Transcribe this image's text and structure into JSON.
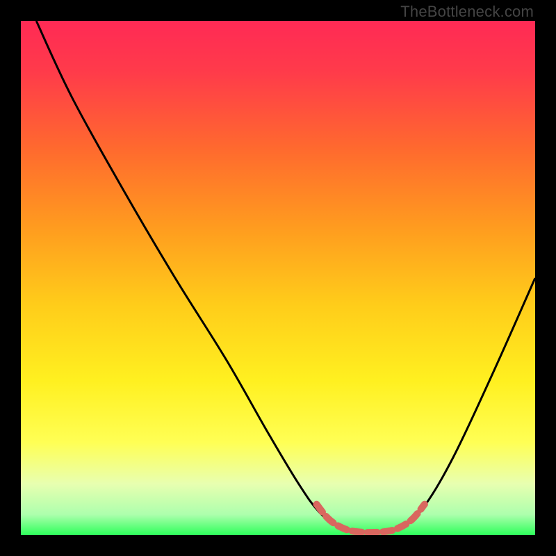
{
  "watermark": "TheBottleneck.com",
  "chart_data": {
    "type": "line",
    "title": "",
    "xlabel": "",
    "ylabel": "",
    "xlim": [
      0,
      100
    ],
    "ylim": [
      0,
      100
    ],
    "gradient_stops": [
      {
        "offset": 0.0,
        "color": "#ff2a55"
      },
      {
        "offset": 0.1,
        "color": "#ff3b4a"
      },
      {
        "offset": 0.25,
        "color": "#ff6a2e"
      },
      {
        "offset": 0.4,
        "color": "#ff9b1f"
      },
      {
        "offset": 0.55,
        "color": "#ffcc1a"
      },
      {
        "offset": 0.7,
        "color": "#fff020"
      },
      {
        "offset": 0.82,
        "color": "#ffff55"
      },
      {
        "offset": 0.9,
        "color": "#e8ffb0"
      },
      {
        "offset": 0.96,
        "color": "#adffad"
      },
      {
        "offset": 1.0,
        "color": "#2dff5a"
      }
    ],
    "series": [
      {
        "name": "bottleneck-curve",
        "color": "#000000",
        "stroke_width": 3,
        "points": [
          {
            "x": 3.0,
            "y": 100.0
          },
          {
            "x": 10.0,
            "y": 85.0
          },
          {
            "x": 20.0,
            "y": 67.0
          },
          {
            "x": 30.0,
            "y": 50.0
          },
          {
            "x": 40.0,
            "y": 34.0
          },
          {
            "x": 48.0,
            "y": 20.0
          },
          {
            "x": 54.0,
            "y": 10.0
          },
          {
            "x": 58.0,
            "y": 4.5
          },
          {
            "x": 62.0,
            "y": 1.5
          },
          {
            "x": 66.0,
            "y": 0.5
          },
          {
            "x": 70.0,
            "y": 0.5
          },
          {
            "x": 74.0,
            "y": 1.5
          },
          {
            "x": 78.0,
            "y": 5.0
          },
          {
            "x": 84.0,
            "y": 15.0
          },
          {
            "x": 92.0,
            "y": 32.0
          },
          {
            "x": 100.0,
            "y": 50.0
          }
        ]
      },
      {
        "name": "optimal-band",
        "color": "#d9675f",
        "stroke_width": 10,
        "dash": [
          14,
          8
        ],
        "points": [
          {
            "x": 57.5,
            "y": 6.0
          },
          {
            "x": 60.0,
            "y": 3.0
          },
          {
            "x": 63.0,
            "y": 1.2
          },
          {
            "x": 66.0,
            "y": 0.6
          },
          {
            "x": 70.0,
            "y": 0.6
          },
          {
            "x": 73.0,
            "y": 1.2
          },
          {
            "x": 76.0,
            "y": 3.0
          },
          {
            "x": 78.5,
            "y": 6.0
          }
        ]
      }
    ]
  }
}
